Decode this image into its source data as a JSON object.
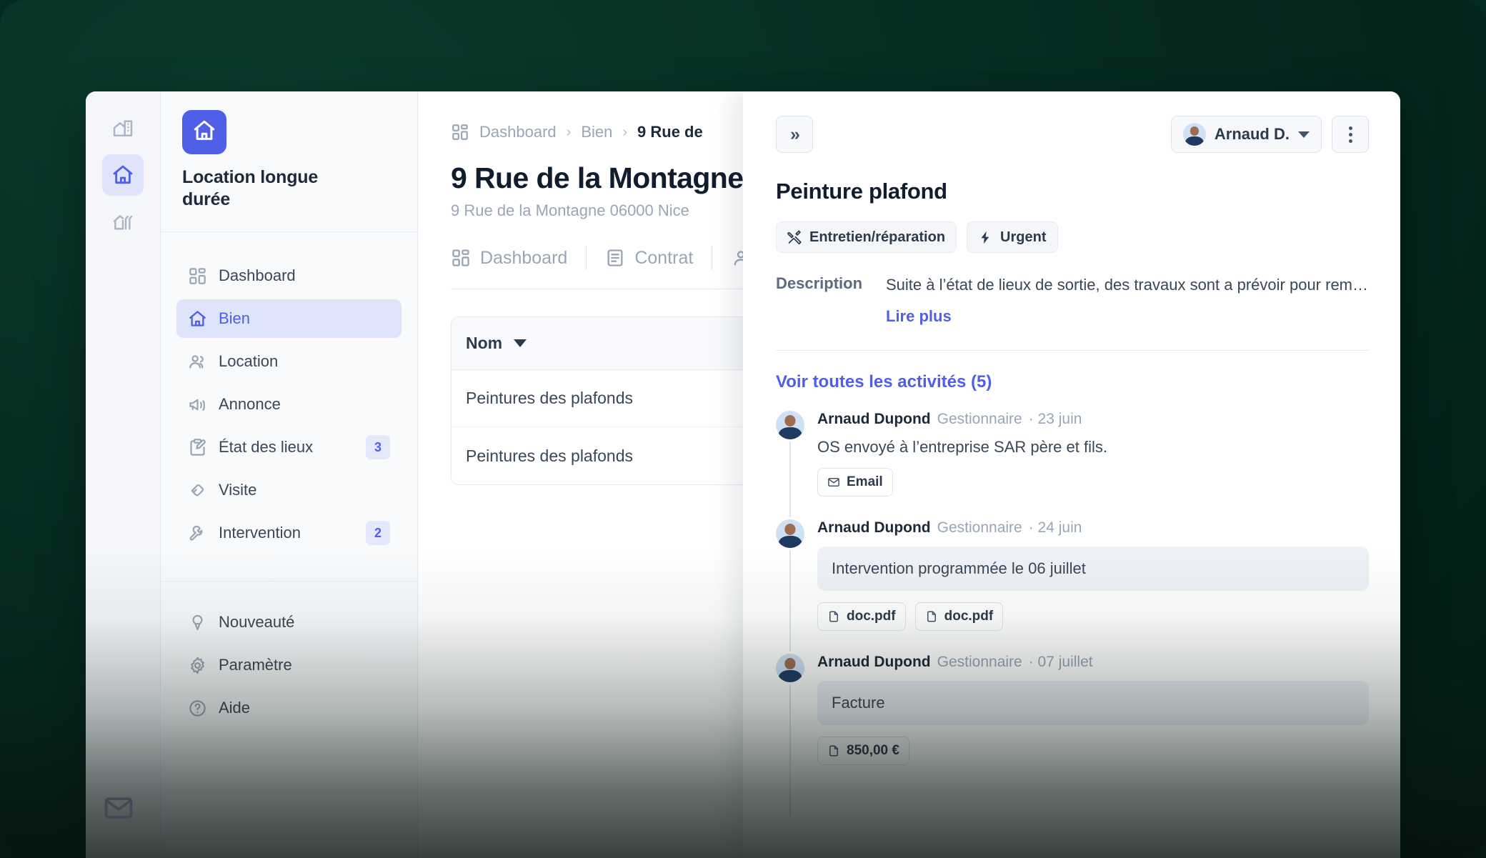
{
  "icon_rail": {
    "items": [
      {
        "name": "building-house-icon",
        "active": false
      },
      {
        "name": "home-icon",
        "active": true
      },
      {
        "name": "house-lines-icon",
        "active": false
      }
    ]
  },
  "sidebar": {
    "brand": {
      "logo_icon": "home-icon",
      "name": "Location longue durée"
    },
    "primary_items": [
      {
        "label": "Dashboard",
        "icon": "dashboard-icon",
        "badge": "",
        "active": false
      },
      {
        "label": "Bien",
        "icon": "home-icon",
        "badge": "",
        "active": true
      },
      {
        "label": "Location",
        "icon": "users-icon",
        "badge": "",
        "active": false
      },
      {
        "label": "Annonce",
        "icon": "megaphone-icon",
        "badge": "",
        "active": false
      },
      {
        "label": "État des lieux",
        "icon": "clipboard-pen-icon",
        "badge": "3",
        "active": false
      },
      {
        "label": "Visite",
        "icon": "handshake-icon",
        "badge": "",
        "active": false
      },
      {
        "label": "Intervention",
        "icon": "wrench-icon",
        "badge": "2",
        "active": false
      }
    ],
    "secondary_items": [
      {
        "label": "Nouveauté",
        "icon": "sparkle-icon",
        "badge": "",
        "active": false
      },
      {
        "label": "Paramètre",
        "icon": "gear-icon",
        "badge": "",
        "active": false
      },
      {
        "label": "Aide",
        "icon": "help-circle-icon",
        "badge": "",
        "active": false
      }
    ]
  },
  "main": {
    "breadcrumb": {
      "icon": "dashboard-icon",
      "items": [
        "Dashboard",
        "Bien"
      ],
      "current": "9 Rue de"
    },
    "title": "9 Rue de la Montagne",
    "subtitle": "9 Rue de la Montagne 06000 Nice",
    "tabs": [
      {
        "label": "Dashboard",
        "icon": "dashboard-icon"
      },
      {
        "label": "Contrat",
        "icon": "document-icon"
      },
      {
        "label": "",
        "icon": "user-icon"
      }
    ],
    "table": {
      "columns": [
        "Nom"
      ],
      "sort_indicator": "caret-down",
      "rows": [
        [
          "Peintures des plafonds"
        ],
        [
          "Peintures des plafonds"
        ]
      ]
    }
  },
  "detail_panel": {
    "collapse_label": "»",
    "user_chip": {
      "label": "Arnaud D.",
      "avatar": "user-avatar"
    },
    "overflow_menu": "kebab-menu",
    "title": "Peinture plafond",
    "tags": [
      {
        "label": "Entretien/réparation",
        "icon": "tools-icon"
      },
      {
        "label": "Urgent",
        "icon": "bolt-icon"
      }
    ],
    "description_label": "Description",
    "description_text": "Suite à l’état de lieux de sortie, des travaux sont a prévoir pour remettr...",
    "read_more_label": "Lire plus",
    "activities_link": "Voir toutes les activités (5)",
    "activities": [
      {
        "author": "Arnaud Dupond",
        "role": "Gestionnaire",
        "date": "23 juin",
        "text": "OS envoyé à l’entreprise SAR père et fils.",
        "boxed": false,
        "chips": [
          {
            "label": "Email",
            "icon": "envelope-icon"
          }
        ]
      },
      {
        "author": "Arnaud Dupond",
        "role": "Gestionnaire",
        "date": "24 juin",
        "text": "Intervention programmée le 06 juillet",
        "boxed": true,
        "chips": [
          {
            "label": "doc.pdf",
            "icon": "file-pdf-icon"
          },
          {
            "label": "doc.pdf",
            "icon": "file-pdf-icon"
          }
        ]
      },
      {
        "author": "Arnaud Dupond",
        "role": "Gestionnaire",
        "date": "07 juillet",
        "text": "Facture",
        "boxed": true,
        "chips": [
          {
            "label": "850,00 €",
            "icon": "file-pdf-icon"
          }
        ]
      }
    ]
  },
  "floating": {
    "mail_icon": "mail-icon"
  },
  "colors": {
    "accent": "#4f5fe8",
    "accent_soft": "#dfe4fb",
    "backdrop": "#042b22",
    "text_dark": "#101d2e",
    "text_muted": "#9aa5b5",
    "border": "#e7ebf2",
    "box_fill": "#eef1f8"
  }
}
